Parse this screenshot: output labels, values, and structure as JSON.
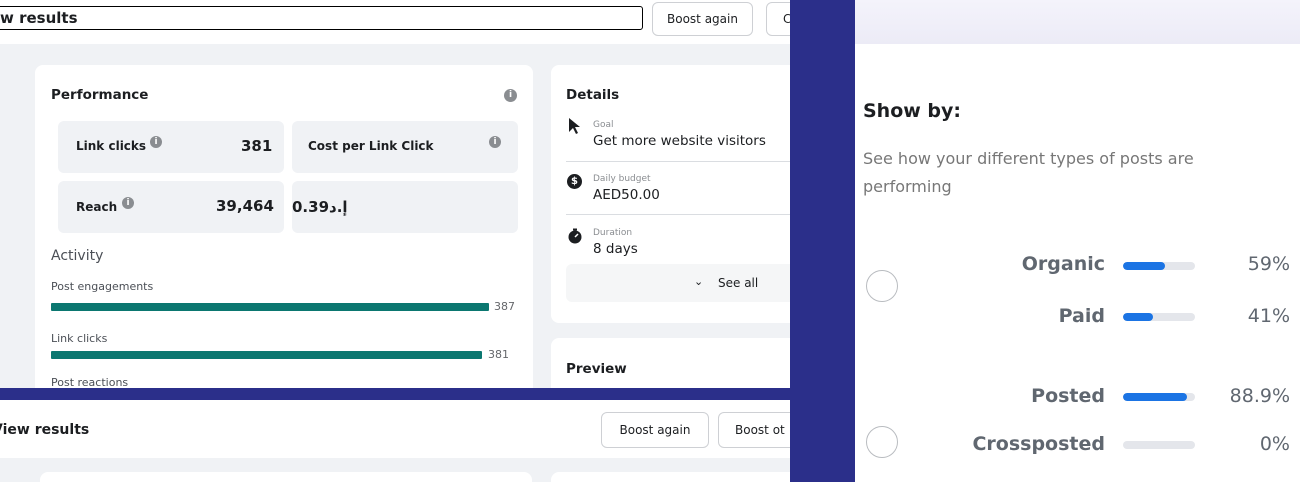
{
  "left_top": {
    "title": "w results",
    "buttons": {
      "boost_again": "Boost again",
      "partial": "C"
    },
    "performance": {
      "title": "Performance",
      "info_glyph": "i",
      "link_clicks_label": "Link clicks",
      "link_clicks_value": "381",
      "cost_label": "Cost per Link Click",
      "cost_value": "0.39د.إ",
      "reach_label": "Reach",
      "reach_value": "39,464"
    },
    "activity": {
      "title": "Activity",
      "items": [
        {
          "label": "Post engagements",
          "value": "387",
          "fraction": 1.0
        },
        {
          "label": "Link clicks",
          "value": "381",
          "fraction": 0.985
        },
        {
          "label": "Post reactions"
        }
      ]
    },
    "details": {
      "title": "Details",
      "goal_label": "Goal",
      "goal_value": "Get more website visitors",
      "budget_label": "Daily budget",
      "budget_value": "AED50.00",
      "duration_label": "Duration",
      "duration_value": "8 days",
      "see_all": "See all"
    },
    "preview": {
      "title": "Preview"
    }
  },
  "left_bottom": {
    "title": "View results",
    "buttons": {
      "boost_again": "Boost again",
      "boost_other": "Boost ot"
    }
  },
  "right_panel": {
    "heading": "Show by:",
    "description": "See how your different types of posts are performing",
    "groups": [
      {
        "rows": [
          {
            "label": "Organic",
            "percent": "59%",
            "fraction": 0.59
          },
          {
            "label": "Paid",
            "percent": "41%",
            "fraction": 0.41
          }
        ]
      },
      {
        "rows": [
          {
            "label": "Posted",
            "percent": "88.9%",
            "fraction": 0.889
          },
          {
            "label": "Crossposted",
            "percent": "0%",
            "fraction": 0.0
          }
        ]
      }
    ],
    "colors": {
      "bar_fill": "#1b74e4",
      "bar_track": "#e4e6eb"
    }
  },
  "colors": {
    "activity_bar": "#0b7770",
    "backdrop": "#2b2f8a"
  }
}
